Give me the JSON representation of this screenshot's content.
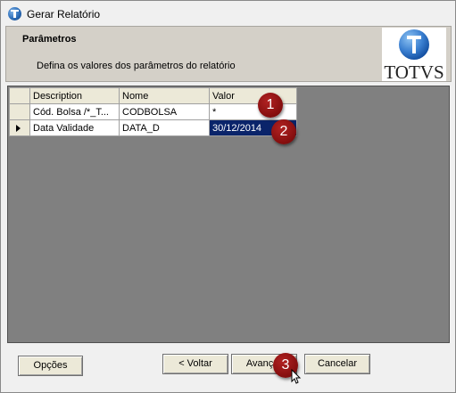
{
  "window": {
    "title": "Gerar Relatório"
  },
  "header": {
    "title": "Parâmetros",
    "subtitle": "Defina os valores dos parâmetros do relatório",
    "logo_text": "TOTVS"
  },
  "grid": {
    "columns": [
      "Description",
      "Nome",
      "Valor"
    ],
    "rows": [
      {
        "description": "Cód. Bolsa /*_T...",
        "nome": "CODBOLSA",
        "valor": "*"
      },
      {
        "description": "Data Validade",
        "nome": "DATA_D",
        "valor": "30/12/2014"
      }
    ]
  },
  "annotations": [
    "1",
    "2",
    "3"
  ],
  "buttons": {
    "opcoes": "Opções",
    "voltar": "< Voltar",
    "avancar": "Avançar",
    "cancelar": "Cancelar"
  },
  "colors": {
    "annotation_badge": "#8a1010",
    "selection": "#0a246a",
    "grid_background": "#808080"
  }
}
